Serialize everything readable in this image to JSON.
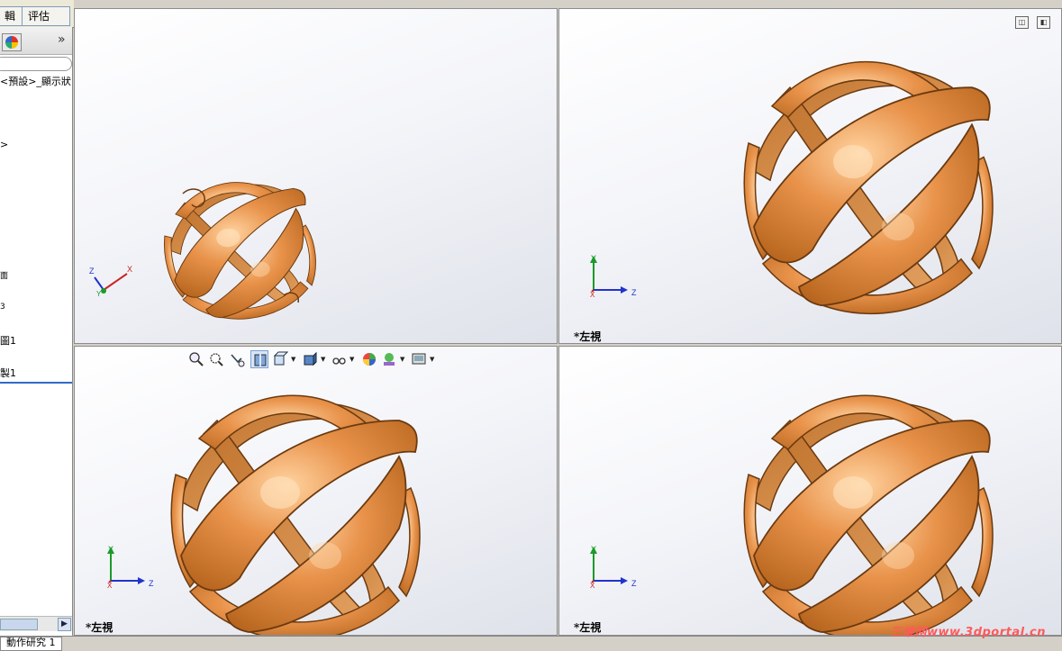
{
  "tabs": {
    "edit_partial": "輯",
    "evaluate": "评估"
  },
  "tree": {
    "display_state": "<預設>_顯示狀!",
    "arrow_item": ">",
    "item_plane": "面",
    "item_sketch_ref": "3",
    "item_sketch": "圖1",
    "item_copy": "製1"
  },
  "icons": {
    "expand": "»",
    "scroll_right": "▶",
    "splitter": "◂"
  },
  "viewports": {
    "top_right_label": "*左視",
    "bottom_left_label": "*左視",
    "bottom_right_label": "*左視"
  },
  "axes": {
    "x": "X",
    "y": "Y",
    "z": "Z"
  },
  "bottom": {
    "motion_tab": "動作研究 1"
  },
  "watermark": "三维网www.3dportal.cn",
  "colors": {
    "band": "#e08a3c",
    "band_dark": "#9a5218",
    "selection": "#316ac5",
    "watermark": "#ff5a5a"
  },
  "view_toolbar": [
    "zoom-to-fit-icon",
    "zoom-to-area-icon",
    "previous-view-icon",
    "section-view-icon",
    "view-orientation-icon",
    "display-style-icon",
    "hide-show-icon",
    "appearance-icon",
    "scene-icon",
    "view-settings-icon"
  ]
}
